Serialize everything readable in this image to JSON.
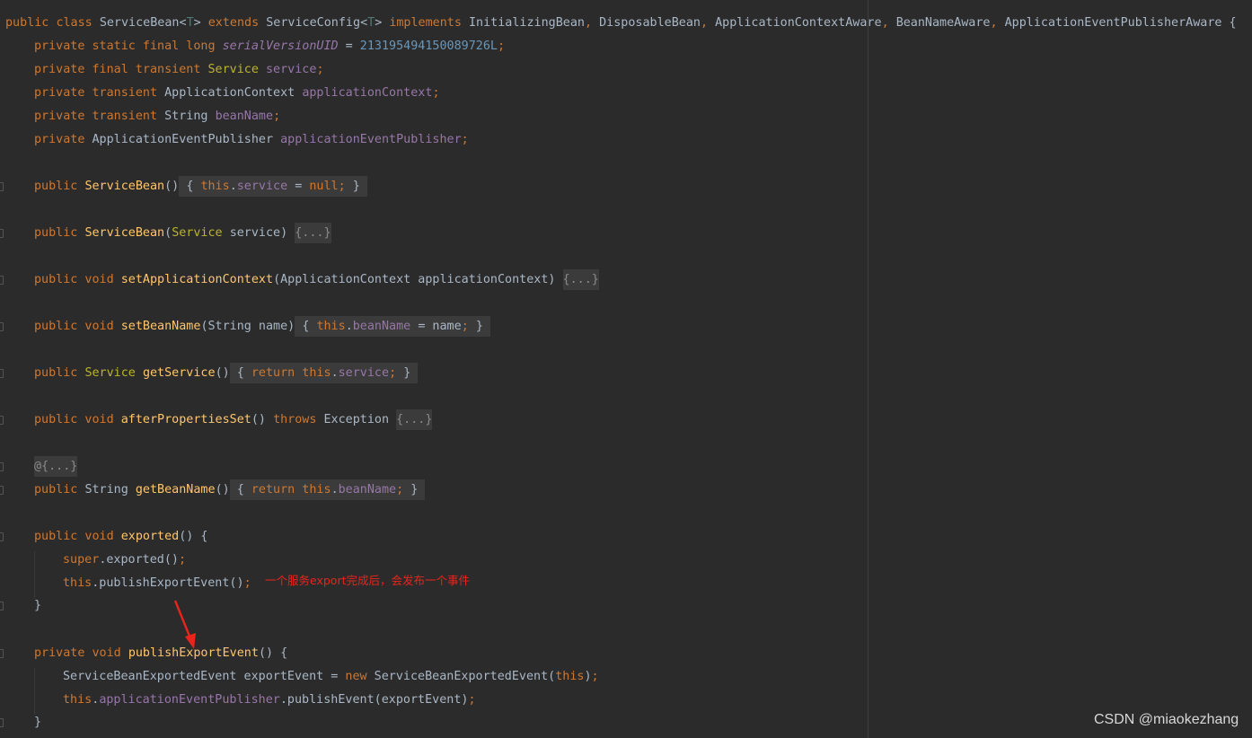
{
  "editor": {
    "background": "#2b2b2b",
    "palette": {
      "keyword": "#cc7832",
      "method": "#ffc66d",
      "field": "#9876aa",
      "number": "#6897bb",
      "plain": "#a9b7c6",
      "annotation_red": "#e8241c"
    },
    "lines": {
      "l1": {
        "kw_public": "public",
        "kw_class": "class",
        "class_name": "ServiceBean",
        "lt1": "<",
        "tparam1": "T",
        "gt1": ">",
        "kw_extends": "extends",
        "super_name": "ServiceConfig",
        "lt2": "<",
        "tparam2": "T",
        "gt2": ">",
        "kw_implements": "implements",
        "iface1": "InitializingBean",
        "comma1": ",",
        "iface2": "DisposableBean",
        "comma2": ",",
        "iface3": "ApplicationContextAware",
        "comma3": ",",
        "iface4": "BeanNameAware",
        "comma4": ",",
        "iface5": "ApplicationEventPublisherAware",
        "brace": "{"
      },
      "l2": {
        "mods": "private static final long",
        "field": "serialVersionUID",
        "eq": "=",
        "num": "213195494150089726L",
        "semi": ";"
      },
      "l3": {
        "mods": "private final transient",
        "type": "Service",
        "field": "service",
        "semi": ";"
      },
      "l4": {
        "mods": "private transient",
        "type": "ApplicationContext",
        "field": "applicationContext",
        "semi": ";"
      },
      "l5": {
        "mods": "private transient",
        "type": "String",
        "field": "beanName",
        "semi": ";"
      },
      "l6": {
        "mods": "private",
        "type": "ApplicationEventPublisher",
        "field": "applicationEventPublisher",
        "semi": ";"
      },
      "l7": {
        "kw": "public",
        "name": "ServiceBean",
        "parens": "()",
        "open": "{",
        "this": "this",
        "dot": ".",
        "field": "service",
        "eq": "=",
        "null": "null",
        "semi": ";",
        "close": "}"
      },
      "l8": {
        "kw": "public",
        "name": "ServiceBean",
        "popen": "(",
        "ptype": "Service",
        "pname": "service",
        "pclose": ")",
        "fold": "{...}"
      },
      "l9": {
        "kw": "public void",
        "name": "setApplicationContext",
        "params": "(ApplicationContext applicationContext)",
        "fold": "{...}"
      },
      "l10": {
        "kw": "public void",
        "name": "setBeanName",
        "params": "(String name)",
        "open": "{",
        "this": "this",
        "dot": ".",
        "field": "beanName",
        "rest": "= name",
        "semi": ";",
        "close": "}"
      },
      "l11": {
        "kw": "public",
        "type": "Service",
        "name": "getService",
        "parens": "()",
        "open": "{",
        "ret": "return this",
        "dot": ".",
        "field": "service",
        "semi": ";",
        "close": "}"
      },
      "l12": {
        "kw": "public void",
        "name": "afterPropertiesSet",
        "parens": "()",
        "throws": "throws",
        "exc": "Exception",
        "fold": "{...}"
      },
      "l13": {
        "fold": "@{...}"
      },
      "l14": {
        "kw": "public",
        "type": "String",
        "name": "getBeanName",
        "parens": "()",
        "open": "{",
        "ret": "return this",
        "dot": ".",
        "field": "beanName",
        "semi": ";",
        "close": "}"
      },
      "l15": {
        "kw": "public void",
        "name": "exported",
        "rest": "() {"
      },
      "l16": {
        "kw": "super",
        "rest": ".exported()",
        "semi": ";"
      },
      "l17": {
        "kw": "this",
        "rest": ".publishExportEvent()",
        "semi": ";"
      },
      "l18": {
        "close": "}"
      },
      "l19": {
        "kw": "private void",
        "name": "publishExportEvent",
        "rest": "() {"
      },
      "l20": {
        "type": "ServiceBeanExportedEvent exportEvent =",
        "kw_new": "new",
        "ctor": "ServiceBeanExportedEvent(",
        "this": "this",
        "rest": ")",
        "semi": ";"
      },
      "l21": {
        "this": "this",
        "dot": ".",
        "field": "applicationEventPublisher",
        "rest": ".publishEvent(exportEvent)",
        "semi": ";"
      },
      "l22": {
        "close": "}"
      }
    }
  },
  "annotation": {
    "text": "一个服务export完成后，会发布一个事件"
  },
  "watermark": {
    "text": "CSDN @miaokezhang"
  }
}
